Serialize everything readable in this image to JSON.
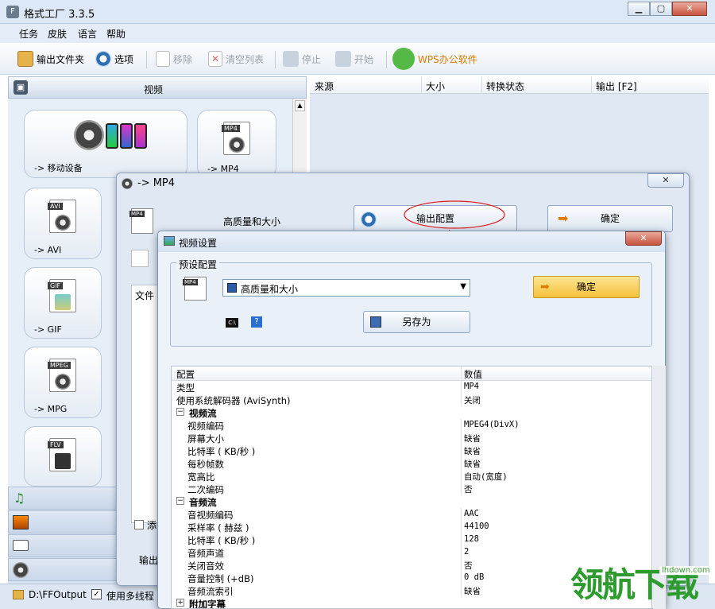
{
  "window": {
    "title": "格式工厂 3.3.5",
    "app_icon": "format-factory-icon"
  },
  "menu": [
    "任务",
    "皮肤",
    "语言",
    "帮助"
  ],
  "toolbar": {
    "output_folder": "输出文件夹",
    "options": "选项",
    "remove": "移除",
    "clear_list": "清空列表",
    "stop": "停止",
    "start": "开始",
    "wps": "WPS办公软件"
  },
  "left": {
    "category_video": "视频",
    "formats": [
      {
        "label": "-> 移动设备",
        "tag": ""
      },
      {
        "label": "-> MP4",
        "tag": "MP4"
      },
      {
        "label": "-> AVI",
        "tag": "AVI"
      },
      {
        "label": "-> GIF",
        "tag": "GIF"
      },
      {
        "label": "-> MPG",
        "tag": "MPEG"
      },
      {
        "label": "",
        "tag": "FLV"
      }
    ]
  },
  "status": {
    "path": "D:\\FFOutput",
    "multithread": "使用多线程"
  },
  "tasklist": {
    "columns": [
      "来源",
      "大小",
      "转换状态",
      "输出 [F2]"
    ]
  },
  "mp4_dialog": {
    "title": "-> MP4",
    "preset_label": "高质量和大小",
    "output_config": "输出配置",
    "ok": "确定",
    "file_col": "文件",
    "add_label": "添",
    "output_label": "输出"
  },
  "video_dialog": {
    "title": "视频设置",
    "preset_group": "预设配置",
    "preset_value": "高质量和大小",
    "ok": "确定",
    "save_as": "另存为",
    "grid_header": {
      "key": "配置",
      "value": "数值"
    },
    "rows": [
      {
        "k": "类型",
        "v": "MP4",
        "indent": 0,
        "section": false
      },
      {
        "k": "使用系统解码器 (AviSynth)",
        "v": "关闭",
        "indent": 0,
        "section": false
      },
      {
        "k": "视频流",
        "v": "",
        "indent": 0,
        "section": true,
        "sign": "−"
      },
      {
        "k": "视频编码",
        "v": "MPEG4(DivX)",
        "indent": 1,
        "section": false
      },
      {
        "k": "屏幕大小",
        "v": "缺省",
        "indent": 1,
        "section": false
      },
      {
        "k": "比特率 ( KB/秒 )",
        "v": "缺省",
        "indent": 1,
        "section": false
      },
      {
        "k": "每秒帧数",
        "v": "缺省",
        "indent": 1,
        "section": false
      },
      {
        "k": "宽高比",
        "v": "自动(宽度)",
        "indent": 1,
        "section": false
      },
      {
        "k": "二次编码",
        "v": "否",
        "indent": 1,
        "section": false
      },
      {
        "k": "音频流",
        "v": "",
        "indent": 0,
        "section": true,
        "sign": "−"
      },
      {
        "k": "音视频编码",
        "v": "AAC",
        "indent": 1,
        "section": false
      },
      {
        "k": "采样率 ( 赫兹 )",
        "v": "44100",
        "indent": 1,
        "section": false
      },
      {
        "k": "比特率 ( KB/秒 )",
        "v": "128",
        "indent": 1,
        "section": false
      },
      {
        "k": "音频声道",
        "v": "2",
        "indent": 1,
        "section": false
      },
      {
        "k": "关闭音效",
        "v": "否",
        "indent": 1,
        "section": false
      },
      {
        "k": "音量控制 (+dB)",
        "v": "0 dB",
        "indent": 1,
        "section": false
      },
      {
        "k": "音频流索引",
        "v": "缺省",
        "indent": 1,
        "section": false
      },
      {
        "k": "附加字幕",
        "v": "",
        "indent": 0,
        "section": true,
        "sign": "+"
      }
    ]
  },
  "watermark": {
    "text": "领航下载",
    "domain": "lhdown.com"
  },
  "colors": {
    "accent": "#e07a00",
    "annotation": "#e02020",
    "ok_button": "#f6c23a"
  }
}
